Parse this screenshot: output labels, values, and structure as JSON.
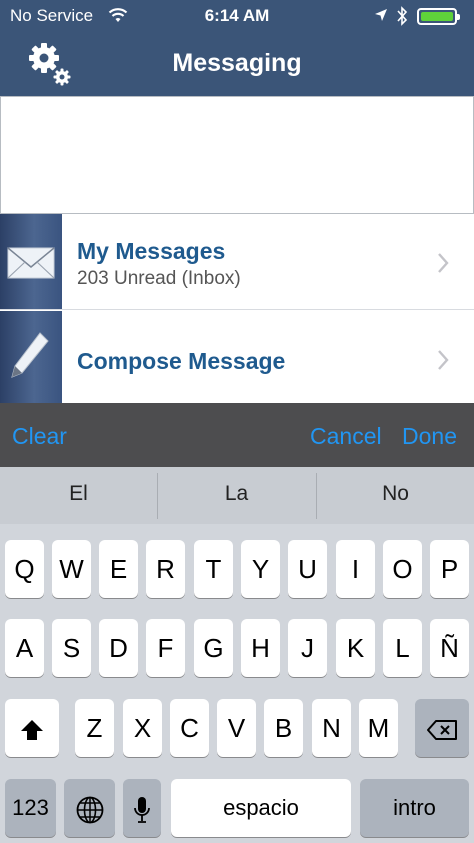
{
  "status_bar": {
    "carrier": "No Service",
    "time": "6:14 AM",
    "icons": [
      "wifi-icon",
      "location-arrow-icon",
      "bluetooth-icon",
      "battery-icon"
    ]
  },
  "nav": {
    "title": "Messaging",
    "settings_icon": "gear-icon"
  },
  "list": [
    {
      "title": "My Messages",
      "subtitle": "203 Unread (Inbox)",
      "icon": "envelope-icon"
    },
    {
      "title": "Compose Message",
      "subtitle": "",
      "icon": "pencil-icon"
    }
  ],
  "accessory_bar": {
    "clear": "Clear",
    "cancel": "Cancel",
    "done": "Done"
  },
  "suggestions": [
    "El",
    "La",
    "No"
  ],
  "keyboard": {
    "row1": [
      "Q",
      "W",
      "E",
      "R",
      "T",
      "Y",
      "U",
      "I",
      "O",
      "P"
    ],
    "row2": [
      "A",
      "S",
      "D",
      "F",
      "G",
      "H",
      "J",
      "K",
      "L",
      "Ñ"
    ],
    "row3": [
      "Z",
      "X",
      "C",
      "V",
      "B",
      "N",
      "M"
    ],
    "numbers_key": "123",
    "space_key": "espacio",
    "return_key": "intro",
    "special_icons": [
      "shift-icon",
      "backspace-icon",
      "globe-icon",
      "microphone-icon"
    ]
  },
  "colors": {
    "nav_bar": "#3b5578",
    "link_blue": "#1f5a8e",
    "accessory_blue": "#2196f3",
    "keyboard_bg": "#d1d5db",
    "battery": "#5fd23a"
  }
}
